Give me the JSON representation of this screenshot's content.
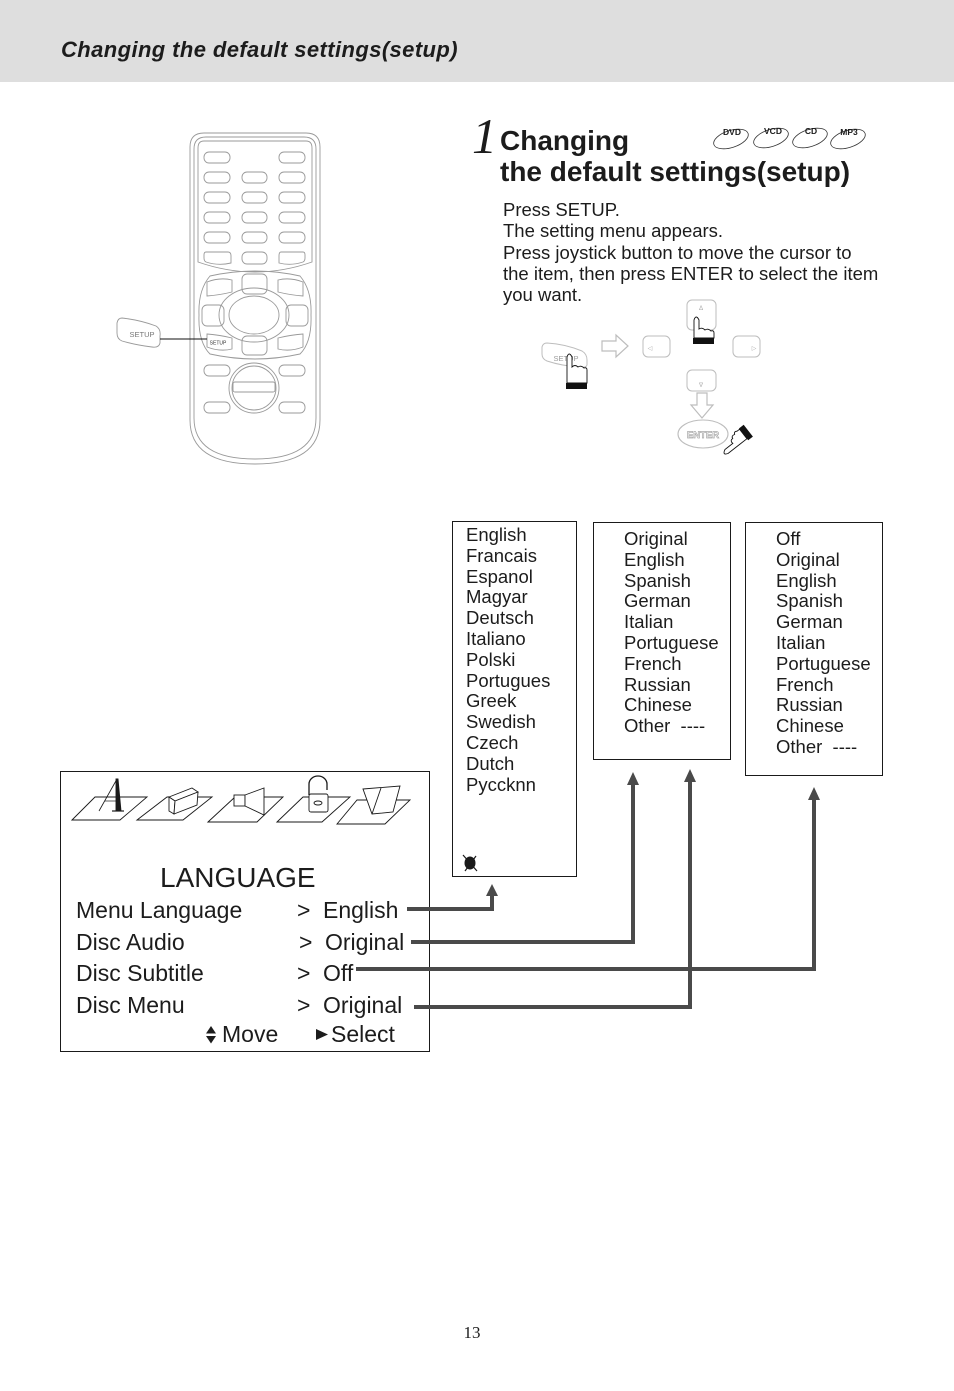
{
  "colors": {
    "header_band": "#dedede",
    "connector": "#4a4a4a"
  },
  "header": {
    "title": "Changing the default settings(setup)"
  },
  "step": {
    "number": "1",
    "title_line1": "Changing",
    "title_line2": "the default settings(setup)",
    "disc_badges": [
      "DVD",
      "VCD",
      "CD",
      "MP3"
    ]
  },
  "instructions": {
    "lines": [
      "Press SETUP.",
      "The setting menu appears.",
      "Press joystick button to move the cursor to",
      "the item, then press ENTER to select the item",
      "you want."
    ]
  },
  "remote": {
    "setup_callout_label": "SETUP",
    "setup_key_label": "SETUP"
  },
  "joystick_diagram": {
    "setup_label": "SETUP",
    "enter_label": "ENTER",
    "up_glyph": "Δ",
    "down_glyph": "∇",
    "left_glyph": "◁",
    "right_glyph": "▷"
  },
  "option_lists": {
    "menu_language": [
      "English",
      "Francais",
      "Espanol",
      "Magyar",
      "Deutsch",
      "Italiano",
      "Polski",
      "Portugues",
      "Greek",
      "Swedish",
      "Czech",
      "Dutch",
      "Pyccknn"
    ],
    "disc_audio_and_menu": [
      "Original",
      "English",
      "Spanish",
      "German",
      "Italian",
      "Portuguese",
      "French",
      "Russian",
      "Chinese",
      "Other  ----"
    ],
    "disc_subtitle": [
      "Off",
      "Original",
      "English",
      "Spanish",
      "German",
      "Italian",
      "Portuguese",
      "French",
      "Russian",
      "Chinese",
      "Other  ----"
    ]
  },
  "osd": {
    "title": "LANGUAGE",
    "tab_icons": [
      "language-icon",
      "video-icon",
      "audio-icon",
      "parental-lock-icon",
      "misc-icon"
    ],
    "rows": [
      {
        "label": "Menu Language",
        "arrow": ">",
        "value": "English"
      },
      {
        "label": "Disc Audio",
        "arrow": ">",
        "value": "Original"
      },
      {
        "label": "Disc Subtitle",
        "arrow": ">",
        "value": "Off"
      },
      {
        "label": "Disc Menu",
        "arrow": ">",
        "value": "Original"
      }
    ],
    "footer": {
      "move_label": "Move",
      "select_label": "Select"
    }
  },
  "page_number": "13"
}
